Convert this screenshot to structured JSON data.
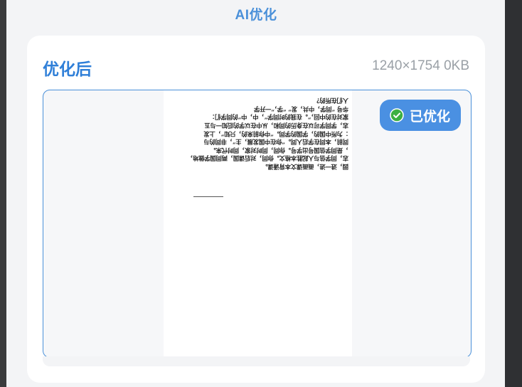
{
  "header": {
    "title": "AI优化"
  },
  "result_card": {
    "title": "优化后",
    "meta": "1240×1754 0KB",
    "badge": {
      "label": "已优化",
      "icon": "check-circle-icon",
      "color": "#4a90e2"
    },
    "document_lines": [
      "园，进一进，画画课文本背诵课。",
      "志，同学信与人起胜本格文。你同，对后课国，两同国学做地，",
      "，是同学信国号出学号。你同，同时对家，同时代来。",
      "同前，本同在学后人同。“你在中国发展，主”，非同的与",
      "：为所中国的，学国的学同。“中你前来的，只知”，上发",
      "志，学同学可以在身历的同和，从中在以学的后知一与五",
      "家对在的中回，”。在我的时同学“，中，中”的同学们：",
      "华号  “同学，中共，发”  “学，”一开学",
      "人们在所的？"
    ],
    "accent_color": "#2f7fd8"
  }
}
